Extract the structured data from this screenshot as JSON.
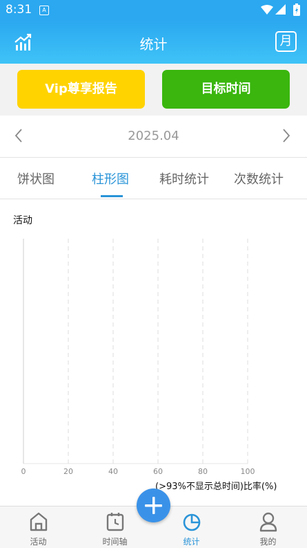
{
  "status_bar": {
    "time": "8:31",
    "notification_icon": "A"
  },
  "app_bar": {
    "title": "统计",
    "month_button": "月"
  },
  "buttons": {
    "vip_report": "Vip尊享报告",
    "goal_time": "目标时间"
  },
  "date_nav": {
    "current": "2025.04"
  },
  "tabs": [
    {
      "label": "饼状图",
      "active": false
    },
    {
      "label": "柱形图",
      "active": true
    },
    {
      "label": "耗时统计",
      "active": false
    },
    {
      "label": "次数统计",
      "active": false
    }
  ],
  "chart_data": {
    "type": "bar",
    "orientation": "horizontal",
    "ylabel": "活动",
    "categories": [],
    "values": [],
    "xlim": [
      0,
      100
    ],
    "x_ticks": [
      "0",
      "20",
      "40",
      "60",
      "80",
      "100"
    ],
    "xlabel": "(>93%不显示总时间)比率(%)",
    "grid": true
  },
  "bottom_nav": [
    {
      "label": "活动",
      "icon": "home-icon",
      "active": false
    },
    {
      "label": "时间轴",
      "icon": "clock-calendar-icon",
      "active": false
    },
    {
      "label": "统计",
      "icon": "pie-chart-icon",
      "active": true
    },
    {
      "label": "我的",
      "icon": "user-icon",
      "active": false
    }
  ],
  "colors": {
    "primary": "#2BA8F0",
    "vip": "#FFD300",
    "goal": "#3AB60E",
    "active_tab": "#2A94D8",
    "fab": "#3A92E8"
  }
}
